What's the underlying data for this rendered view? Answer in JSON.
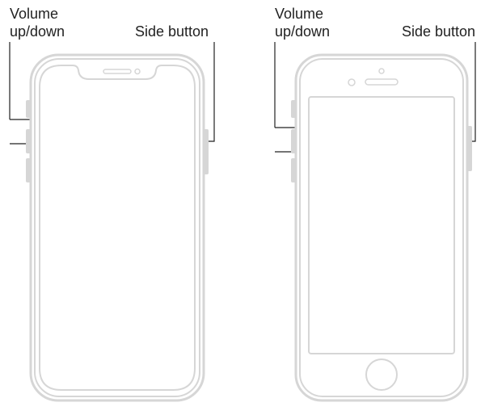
{
  "diagram": {
    "phones": [
      {
        "type": "notch",
        "labels": {
          "volume": "Volume\nup/down",
          "side": "Side button"
        }
      },
      {
        "type": "home-button",
        "labels": {
          "volume": "Volume\nup/down",
          "side": "Side button"
        }
      }
    ]
  }
}
